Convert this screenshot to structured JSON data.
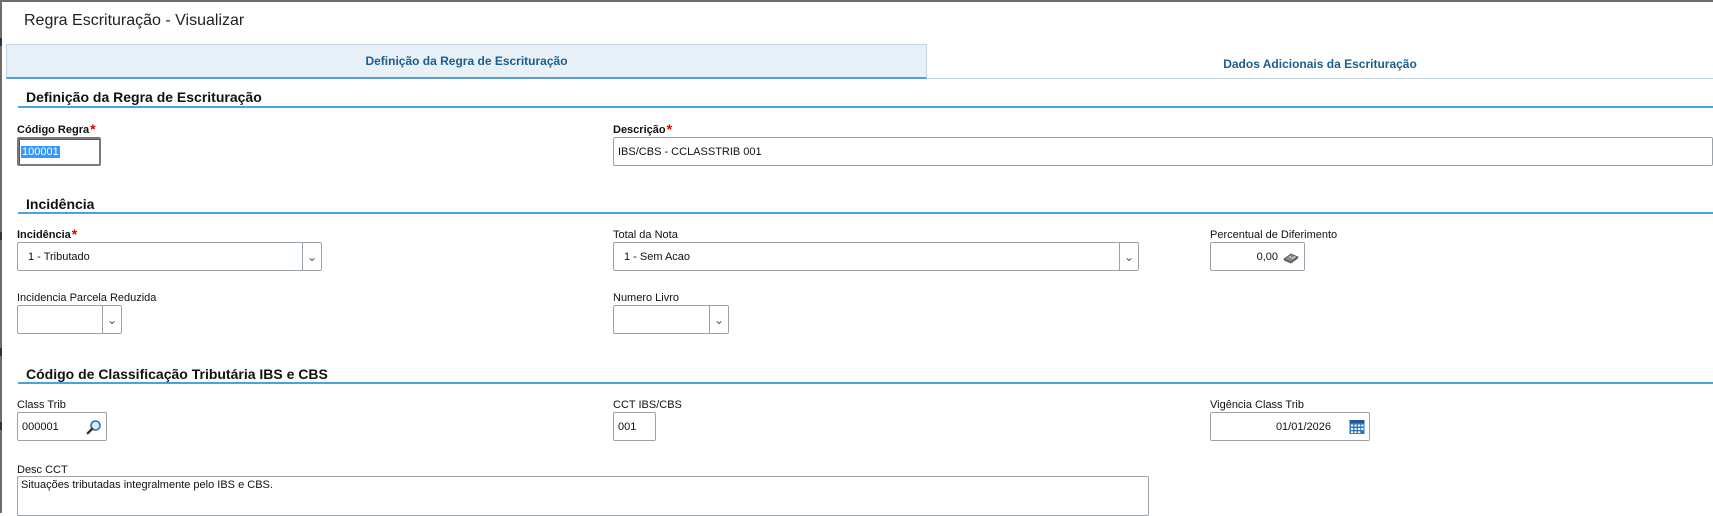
{
  "window": {
    "title": "Regra Escrituração - Visualizar"
  },
  "tabs": [
    {
      "label": "Definição da Regra de Escrituração",
      "active": true
    },
    {
      "label": "Dados Adicionais da Escrituração",
      "active": false
    }
  ],
  "sections": {
    "definicao": {
      "title": "Definição da Regra de Escrituração",
      "codigo_regra": {
        "label": "Código Regra",
        "required_mark": "*",
        "value": "100001"
      },
      "descricao": {
        "label": "Descrição",
        "required_mark": "*",
        "value": "IBS/CBS - CCLASSTRIB 001"
      }
    },
    "incidencia": {
      "title": "Incidência",
      "incidencia": {
        "label": "Incidência",
        "required_mark": "*",
        "value": "1 - Tributado"
      },
      "total_nota": {
        "label": "Total da Nota",
        "value": "1 - Sem Acao"
      },
      "percentual_diferimento": {
        "label": "Percentual de Diferimento",
        "value": "0,00"
      },
      "incidencia_parcela_reduzida": {
        "label": "Incidencia Parcela Reduzida",
        "value": ""
      },
      "numero_livro": {
        "label": "Numero Livro",
        "value": ""
      }
    },
    "classificacao": {
      "title": "Código de Classificação Tributária IBS e CBS",
      "class_trib": {
        "label": "Class Trib",
        "value": "000001"
      },
      "cct": {
        "label": "CCT IBS/CBS",
        "value": "001"
      },
      "vigencia": {
        "label": "Vigência Class Trib",
        "value": "01/01/2026"
      },
      "desc_cct": {
        "label": "Desc CCT",
        "value": "Situações tributadas integralmente pelo IBS e CBS."
      }
    }
  },
  "icons": {
    "dropdown": "chevron-down-icon",
    "calculator": "calculator-icon",
    "search": "search-icon",
    "calendar": "calendar-icon"
  },
  "colors": {
    "accent": "#4aa3df",
    "tab_text": "#1b5e8c",
    "required": "#d80000",
    "selection": "#3399ff"
  }
}
